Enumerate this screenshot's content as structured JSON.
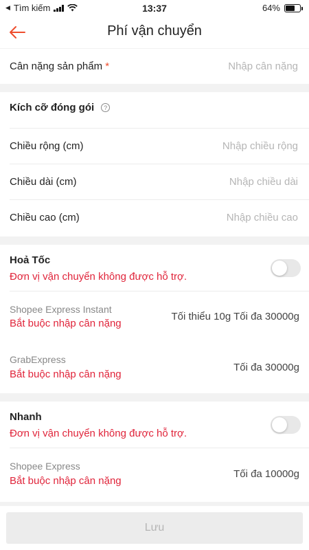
{
  "status_bar": {
    "carrier_back": "Tìm kiếm",
    "time": "13:37",
    "battery": "64%",
    "battery_level": 0.64
  },
  "header": {
    "title": "Phí vận chuyển"
  },
  "weight": {
    "label": "Cân nặng sản phẩm",
    "required_mark": "*",
    "placeholder": "Nhập cân nặng"
  },
  "package_size": {
    "title": "Kích cỡ đóng gói",
    "help_icon": "?",
    "fields": [
      {
        "label": "Chiều rộng (cm)",
        "placeholder": "Nhập chiều rộng"
      },
      {
        "label": "Chiều dài (cm)",
        "placeholder": "Nhập chiều dài"
      },
      {
        "label": "Chiều cao (cm)",
        "placeholder": "Nhập chiều cao"
      }
    ]
  },
  "express": {
    "title": "Hoả Tốc",
    "warning": "Đơn vị vận chuyển không được hỗ trợ.",
    "enabled": false,
    "carriers": [
      {
        "name": "Shopee Express Instant",
        "warning": "Bắt buộc nhập cân nặng",
        "limit": "Tối thiểu 10g Tối đa 30000g"
      },
      {
        "name": "GrabExpress",
        "warning": "Bắt buộc nhập cân nặng",
        "limit": "Tối đa 30000g"
      }
    ]
  },
  "fast": {
    "title": "Nhanh",
    "warning": "Đơn vị vận chuyển không được hỗ trợ.",
    "enabled": false,
    "carriers": [
      {
        "name": "Shopee Express",
        "warning": "Bắt buộc nhập cân nặng",
        "limit": "Tối đa 10000g"
      }
    ]
  },
  "footer": {
    "save_label": "Lưu"
  },
  "colors": {
    "accent": "#ee4d2d",
    "error": "#e0243a"
  }
}
